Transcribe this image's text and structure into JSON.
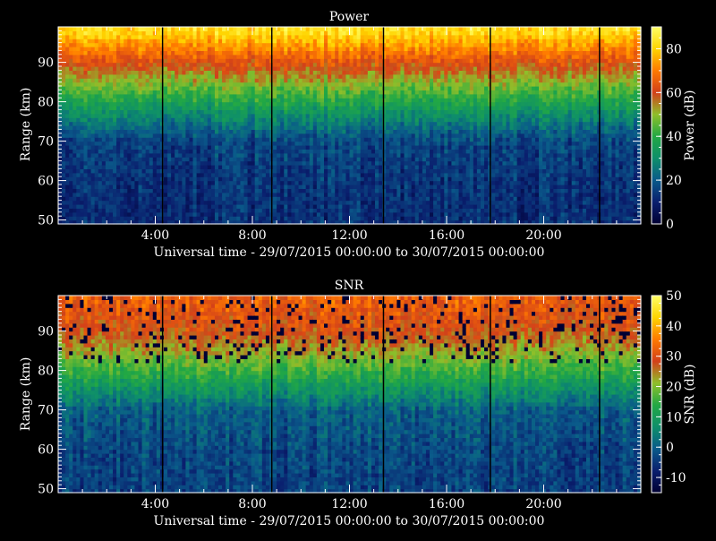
{
  "chart_data": [
    {
      "type": "heatmap",
      "title": "Power",
      "xlabel": "Universal time - 29/07/2015 00:00:00 to 30/07/2015 00:00:00",
      "ylabel": "Range (km)",
      "xlim": [
        0,
        24
      ],
      "ylim": [
        49,
        99
      ],
      "x_ticks": [
        4,
        8,
        12,
        16,
        20
      ],
      "x_tick_labels": [
        "4:00",
        "8:00",
        "12:00",
        "16:00",
        "20:00"
      ],
      "y_ticks": [
        50,
        60,
        70,
        80,
        90
      ],
      "y_tick_labels": [
        "50",
        "60",
        "70",
        "80",
        "90"
      ],
      "colorbar": {
        "label": "Power (dB)",
        "range": [
          0,
          90
        ],
        "ticks": [
          0,
          20,
          40,
          60,
          80
        ],
        "tick_labels": [
          "0",
          "20",
          "40",
          "60",
          "80"
        ]
      },
      "profile": [
        {
          "range": 50,
          "value": 12
        },
        {
          "range": 60,
          "value": 13
        },
        {
          "range": 70,
          "value": 16
        },
        {
          "range": 74,
          "value": 24
        },
        {
          "range": 78,
          "value": 33
        },
        {
          "range": 82,
          "value": 42
        },
        {
          "range": 86,
          "value": 52
        },
        {
          "range": 90,
          "value": 62
        },
        {
          "range": 94,
          "value": 72
        },
        {
          "range": 98,
          "value": 82
        }
      ],
      "data_gaps_ut": [
        4.3,
        8.8,
        13.4,
        17.8,
        22.3
      ]
    },
    {
      "type": "heatmap",
      "title": "SNR",
      "xlabel": "Universal time - 29/07/2015 00:00:00 to 30/07/2015 00:00:00",
      "ylabel": "Range (km)",
      "xlim": [
        0,
        24
      ],
      "ylim": [
        49,
        99
      ],
      "x_ticks": [
        4,
        8,
        12,
        16,
        20
      ],
      "x_tick_labels": [
        "4:00",
        "8:00",
        "12:00",
        "16:00",
        "20:00"
      ],
      "y_ticks": [
        50,
        60,
        70,
        80,
        90
      ],
      "y_tick_labels": [
        "50",
        "60",
        "70",
        "80",
        "90"
      ],
      "colorbar": {
        "label": "SNR (dB)",
        "range": [
          -15,
          50
        ],
        "ticks": [
          -10,
          0,
          10,
          20,
          30,
          40,
          50
        ],
        "tick_labels": [
          "-10",
          "0",
          "10",
          "20",
          "30",
          "40",
          "50"
        ]
      },
      "profile": [
        {
          "range": 50,
          "value": -4
        },
        {
          "range": 60,
          "value": -3
        },
        {
          "range": 70,
          "value": 0
        },
        {
          "range": 74,
          "value": 6
        },
        {
          "range": 78,
          "value": 12
        },
        {
          "range": 82,
          "value": 18
        },
        {
          "range": 86,
          "value": 24
        },
        {
          "range": 90,
          "value": 28
        },
        {
          "range": 94,
          "value": 30
        },
        {
          "range": 98,
          "value": 32
        }
      ],
      "data_gaps_ut": [
        4.3,
        8.8,
        13.4,
        17.8,
        22.3
      ]
    }
  ],
  "colors": {
    "background": "#000000",
    "foreground": "#ffffff",
    "colormap": [
      "#000033",
      "#0a1f6e",
      "#0a5a8a",
      "#0e8f6a",
      "#22a844",
      "#8fbf2a",
      "#d2401a",
      "#ff7a00",
      "#ffd400",
      "#ffff66"
    ]
  }
}
